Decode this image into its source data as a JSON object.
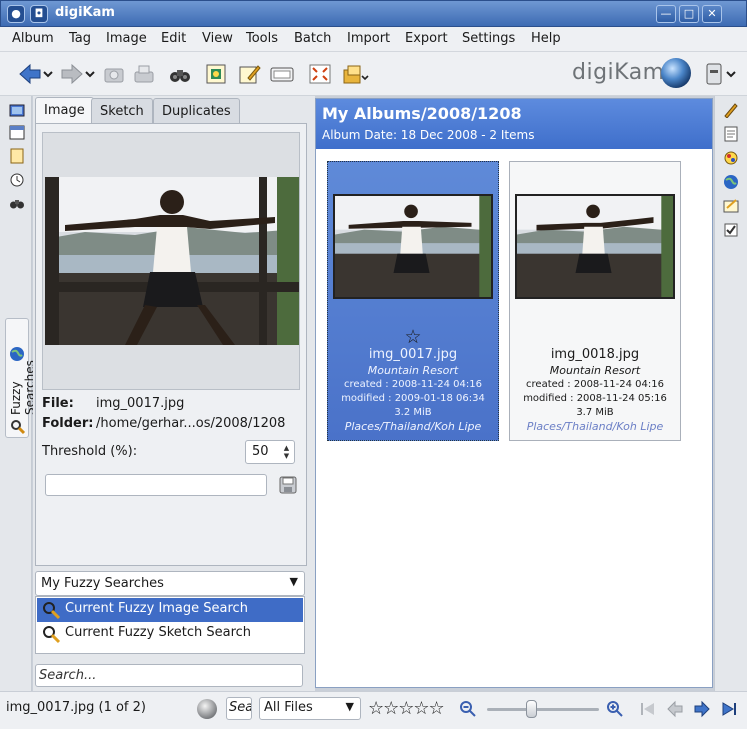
{
  "window": {
    "title": "digiKam",
    "controls": {
      "minimize": "—",
      "maximize": "□",
      "close": "✕"
    }
  },
  "menu": [
    "Album",
    "Tag",
    "Image",
    "Edit",
    "View",
    "Tools",
    "Batch",
    "Import",
    "Export",
    "Settings",
    "Help"
  ],
  "toolbar": {
    "icons": [
      "back-icon",
      "forward-icon",
      "camera-icon",
      "scanner-icon",
      "binoculars-icon",
      "image-editor-icon",
      "edit-icon",
      "slideshow-icon",
      "fullscreen-icon",
      "album-icon"
    ],
    "logo_text": "digiKam"
  },
  "left_sidebar": {
    "vertical_tab": "Fuzzy Searches"
  },
  "fuzzy": {
    "tabs": [
      "Image",
      "Sketch",
      "Duplicates"
    ],
    "active_tab": "Image",
    "file_label": "File:",
    "file_value": "img_0017.jpg",
    "folder_label": "Folder:",
    "folder_value": "/home/gerhar...os/2008/1208",
    "threshold_label": "Threshold (%):",
    "threshold_value": "50",
    "name_value": "",
    "saved_combo": "My Fuzzy Searches",
    "saved_items": [
      "Current Fuzzy Image Search",
      "Current Fuzzy Sketch Search"
    ],
    "search_placeholder": "Search..."
  },
  "album": {
    "title": "My Albums/2008/1208",
    "subtitle": "Album Date: 18 Dec 2008 - 2 Items"
  },
  "items": [
    {
      "name": "img_0017.jpg",
      "title": "Mountain Resort",
      "created": "created : 2008-11-24 04:16",
      "modified": "modified : 2009-01-18 06:34",
      "size": "3.2 MiB",
      "tags": "Places/Thailand/Koh Lipe",
      "rating_star": "☆",
      "selected": true
    },
    {
      "name": "img_0018.jpg",
      "title": "Mountain Resort",
      "created": "created : 2008-11-24 04:16",
      "modified": "modified : 2008-11-24 05:16",
      "size": "3.7 MiB",
      "tags": "Places/Thailand/Koh Lipe",
      "selected": false
    }
  ],
  "status": {
    "text": "img_0017.jpg (1 of 2)",
    "search_value": "Sea",
    "filter": "All Files",
    "rating": "☆☆☆☆☆",
    "zoom_level": 0.4
  },
  "colors": {
    "selection": "#3f6cc6",
    "header": "#4a78d4",
    "tag_text": "#6b7fc6"
  }
}
